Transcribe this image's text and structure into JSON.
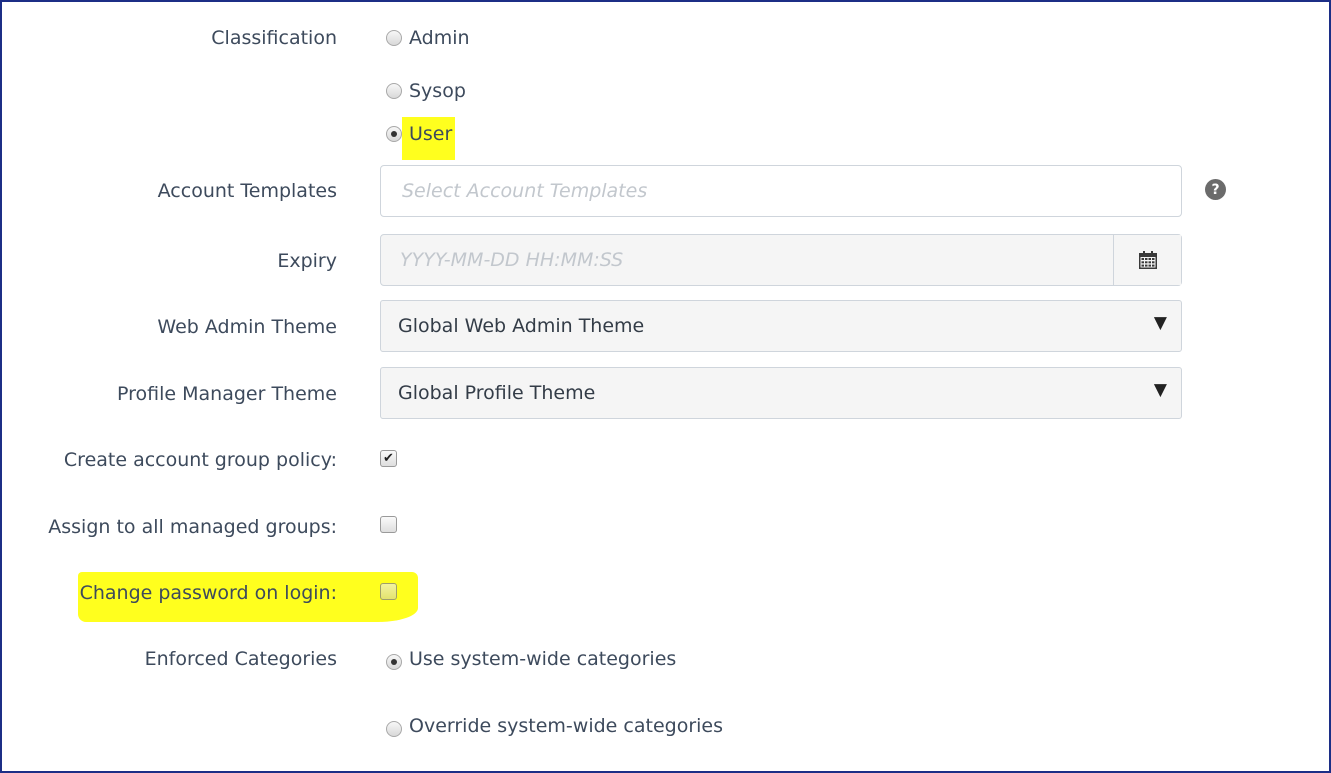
{
  "classification": {
    "label": "Classification",
    "options": [
      {
        "label": "Admin",
        "checked": false
      },
      {
        "label": "Sysop",
        "checked": false
      },
      {
        "label": "User",
        "checked": true
      }
    ]
  },
  "account_templates": {
    "label": "Account Templates",
    "placeholder": "Select Account Templates",
    "help_icon": "question-circle-icon"
  },
  "expiry": {
    "label": "Expiry",
    "placeholder": "YYYY-MM-DD HH:MM:SS",
    "calendar_icon": "calendar-icon"
  },
  "web_admin_theme": {
    "label": "Web Admin Theme",
    "selected": "Global Web Admin Theme"
  },
  "profile_manager_theme": {
    "label": "Profile Manager Theme",
    "selected": "Global Profile Theme"
  },
  "create_account_group_policy": {
    "label": "Create account group policy:",
    "checked": true
  },
  "assign_to_all_managed_groups": {
    "label": "Assign to all managed groups:",
    "checked": false
  },
  "change_password_on_login": {
    "label": "Change password on login:",
    "checked": false
  },
  "enforced_categories": {
    "label": "Enforced Categories",
    "options": [
      {
        "label": "Use system-wide categories",
        "checked": true
      },
      {
        "label": "Override system-wide categories",
        "checked": false
      }
    ]
  },
  "highlight_color": "#ffff1e",
  "frame_border_color": "#1c2e86"
}
